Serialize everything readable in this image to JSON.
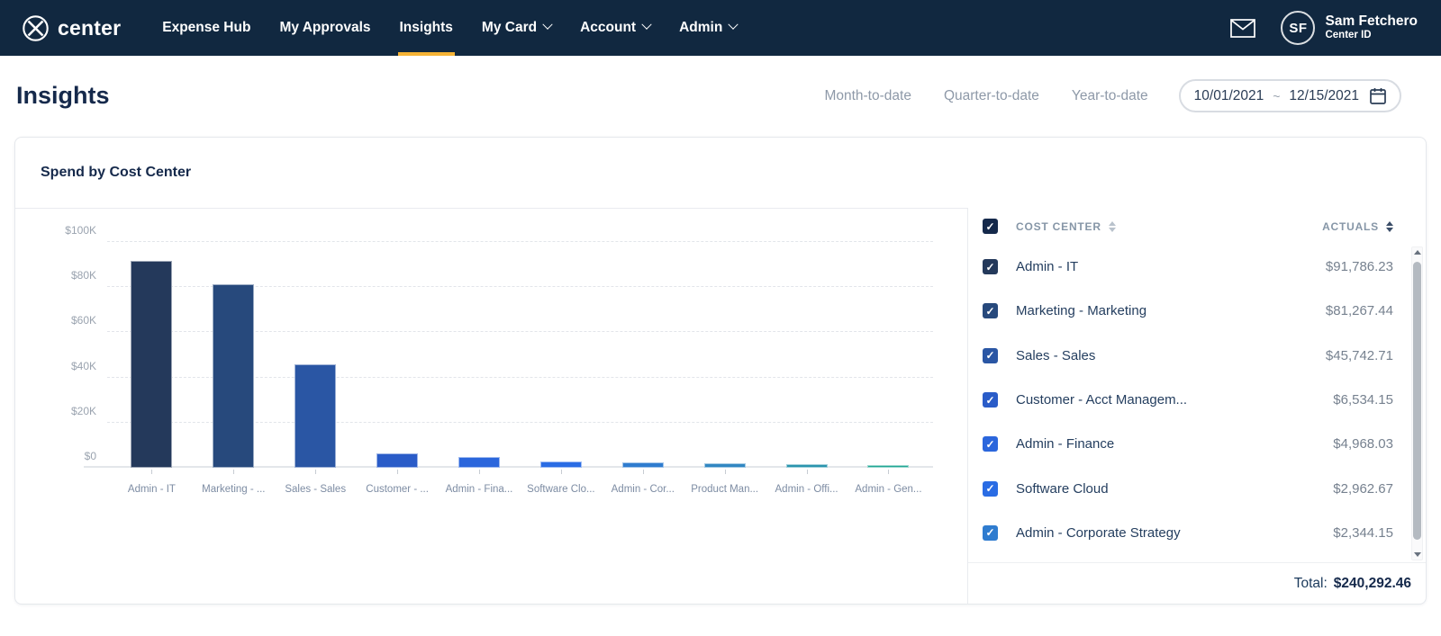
{
  "nav": {
    "brand": "center",
    "items": [
      {
        "label": "Expense Hub",
        "active": false,
        "dropdown": false
      },
      {
        "label": "My Approvals",
        "active": false,
        "dropdown": false
      },
      {
        "label": "Insights",
        "active": true,
        "dropdown": false
      },
      {
        "label": "My Card",
        "active": false,
        "dropdown": true
      },
      {
        "label": "Account",
        "active": false,
        "dropdown": true
      },
      {
        "label": "Admin",
        "active": false,
        "dropdown": true
      }
    ],
    "user": {
      "initials": "SF",
      "name": "Sam Fetchero",
      "subtitle": "Center ID"
    }
  },
  "page": {
    "title": "Insights"
  },
  "filters": {
    "presets": [
      "Month-to-date",
      "Quarter-to-date",
      "Year-to-date"
    ],
    "date_range": {
      "start": "10/01/2021",
      "separator": "~",
      "end": "12/15/2021"
    }
  },
  "card": {
    "title": "Spend by Cost Center"
  },
  "chart_data": {
    "type": "bar",
    "title": "Spend by Cost Center",
    "categories": [
      "Admin - IT",
      "Marketing - ...",
      "Sales - Sales",
      "Customer - ...",
      "Admin - Fina...",
      "Software Clo...",
      "Admin - Cor...",
      "Product Man...",
      "Admin - Offi...",
      "Admin - Gen..."
    ],
    "values": [
      91786.23,
      81267.44,
      45742.71,
      6534.15,
      4968.03,
      2962.67,
      2344.15,
      2000,
      1550,
      1137
    ],
    "bar_colors": [
      "#24395B",
      "#27497C",
      "#2A56A4",
      "#2A5CC8",
      "#2B66DC",
      "#2A6CE4",
      "#2F7CCF",
      "#3187C2",
      "#2B95AE",
      "#22A794"
    ],
    "xlabel": "",
    "ylabel": "",
    "ylim": [
      0,
      100000
    ],
    "yticks": [
      "$0",
      "$20K",
      "$40K",
      "$60K",
      "$80K",
      "$100K"
    ],
    "grid": "dashed horizontal"
  },
  "table": {
    "headers": [
      {
        "label": "COST CENTER"
      },
      {
        "label": "ACTUALS"
      }
    ],
    "rows": [
      {
        "checked": true,
        "cost_center": "Admin - IT",
        "actuals": "$91,786.23",
        "color": "#24395B"
      },
      {
        "checked": true,
        "cost_center": "Marketing - Marketing",
        "actuals": "$81,267.44",
        "color": "#27497C"
      },
      {
        "checked": true,
        "cost_center": "Sales - Sales",
        "actuals": "$45,742.71",
        "color": "#2A56A4"
      },
      {
        "checked": true,
        "cost_center": "Customer - Acct Managem...",
        "actuals": "$6,534.15",
        "color": "#2A5CC8"
      },
      {
        "checked": true,
        "cost_center": "Admin - Finance",
        "actuals": "$4,968.03",
        "color": "#2B66DC"
      },
      {
        "checked": true,
        "cost_center": "Software Cloud",
        "actuals": "$2,962.67",
        "color": "#2A6CE4"
      },
      {
        "checked": true,
        "cost_center": "Admin - Corporate Strategy",
        "actuals": "$2,344.15",
        "color": "#2F7CCF"
      }
    ],
    "total_label": "Total:",
    "total_value": "$240,292.46"
  },
  "colors": {
    "nav_bg": "#112840",
    "accent_yellow": "#F5B335",
    "title_navy": "#15294B"
  }
}
